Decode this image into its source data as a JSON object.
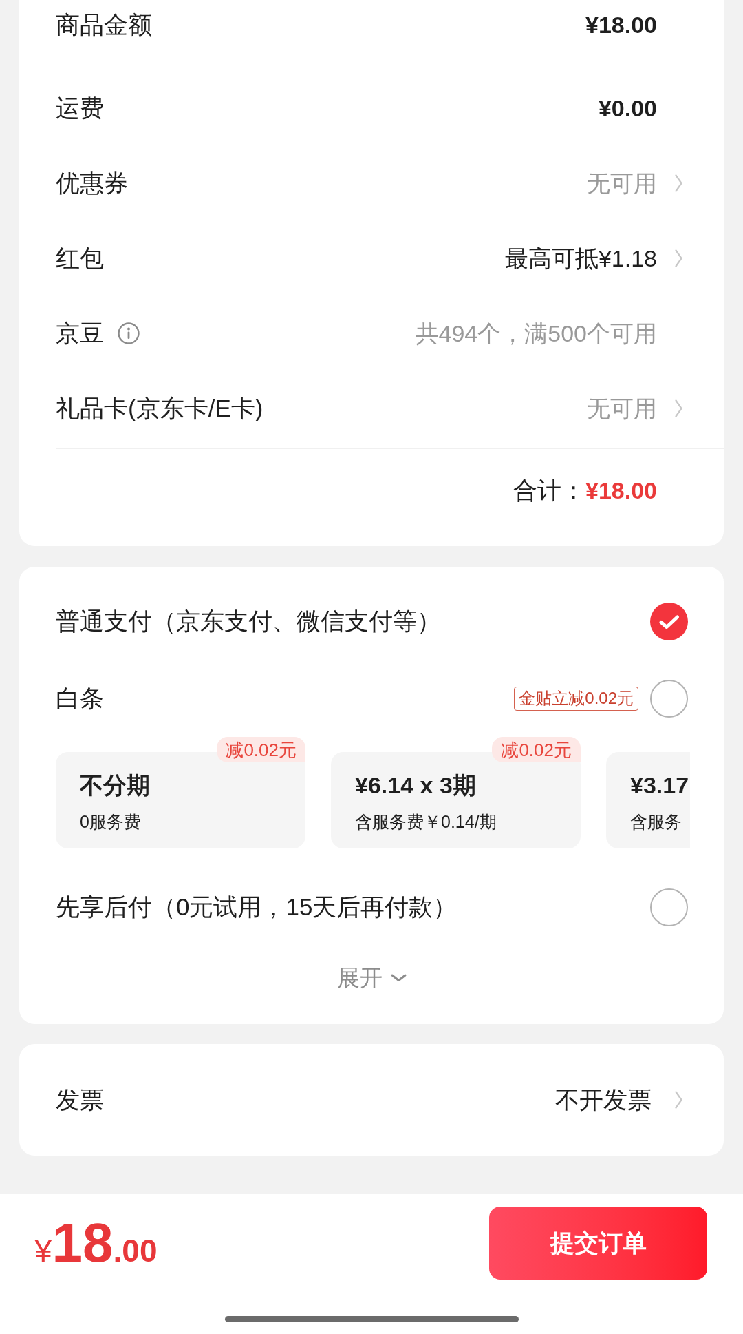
{
  "summary": {
    "rows": [
      {
        "label": "商品金额",
        "value": "¥18.00",
        "kind": "amount",
        "muted": false
      },
      {
        "label": "运费",
        "value": "¥0.00",
        "kind": "amount",
        "muted": false
      },
      {
        "label": "优惠券",
        "value": "无可用",
        "kind": "link",
        "muted": true
      },
      {
        "label": "红包",
        "value": "最高可抵¥1.18",
        "kind": "link",
        "muted": false
      },
      {
        "label": "京豆",
        "value": "共494个，满500个可用",
        "kind": "info",
        "muted": true
      },
      {
        "label": "礼品卡(京东卡/E卡)",
        "value": "无可用",
        "kind": "link",
        "muted": true
      }
    ],
    "total": {
      "label": "合计：",
      "value": "¥18.00"
    }
  },
  "payment": {
    "options": [
      {
        "label": "普通支付（京东支付、微信支付等）",
        "selected": true
      },
      {
        "label": "白条",
        "selected": false,
        "tag": "金贴立减0.02元",
        "plans": [
          {
            "title": "不分期",
            "subtitle": "0服务费",
            "badge": "减0.02元",
            "cut": false
          },
          {
            "title": "¥6.14 x 3期",
            "subtitle": "含服务费￥0.14/期",
            "badge": "减0.02元",
            "cut": false
          },
          {
            "title": "¥3.17",
            "subtitle": "含服务",
            "cut": true
          }
        ]
      },
      {
        "label": "先享后付（0元试用，15天后再付款）",
        "selected": false
      }
    ],
    "expand": "展开"
  },
  "invoice": {
    "label": "发票",
    "value": "不开发票"
  },
  "footer": {
    "price": {
      "currency": "¥",
      "integer": "18",
      "decimal": ".00"
    },
    "submit": "提交订单"
  }
}
